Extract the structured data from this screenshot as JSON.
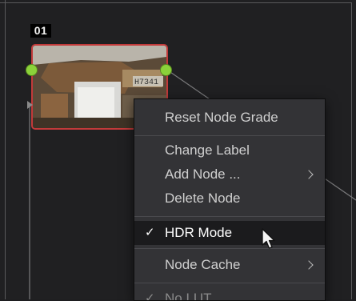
{
  "node": {
    "number": "01",
    "thumbnail_text": "H7341"
  },
  "context_menu": {
    "items": [
      {
        "label": "Reset Node Grade",
        "checked": false,
        "submenu": false
      },
      {
        "label": "Change Label",
        "checked": false,
        "submenu": false
      },
      {
        "label": "Add Node ...",
        "checked": false,
        "submenu": true
      },
      {
        "label": "Delete Node",
        "checked": false,
        "submenu": false
      },
      {
        "label": "HDR Mode",
        "checked": true,
        "submenu": false,
        "highlighted": true
      },
      {
        "label": "Node Cache",
        "checked": false,
        "submenu": true
      },
      {
        "label": "No LUT",
        "checked": true,
        "submenu": false
      }
    ],
    "check_glyph": "✓"
  },
  "colors": {
    "node_border": "#c23a3a",
    "connector_dot": "#8bd23a",
    "menu_bg": "#333336",
    "highlight_bg": "#1b1b1d"
  },
  "icons": [
    "connector-dot-icon",
    "input-triangle-icon",
    "chevron-right-icon",
    "checkmark-icon",
    "mouse-pointer-icon"
  ]
}
